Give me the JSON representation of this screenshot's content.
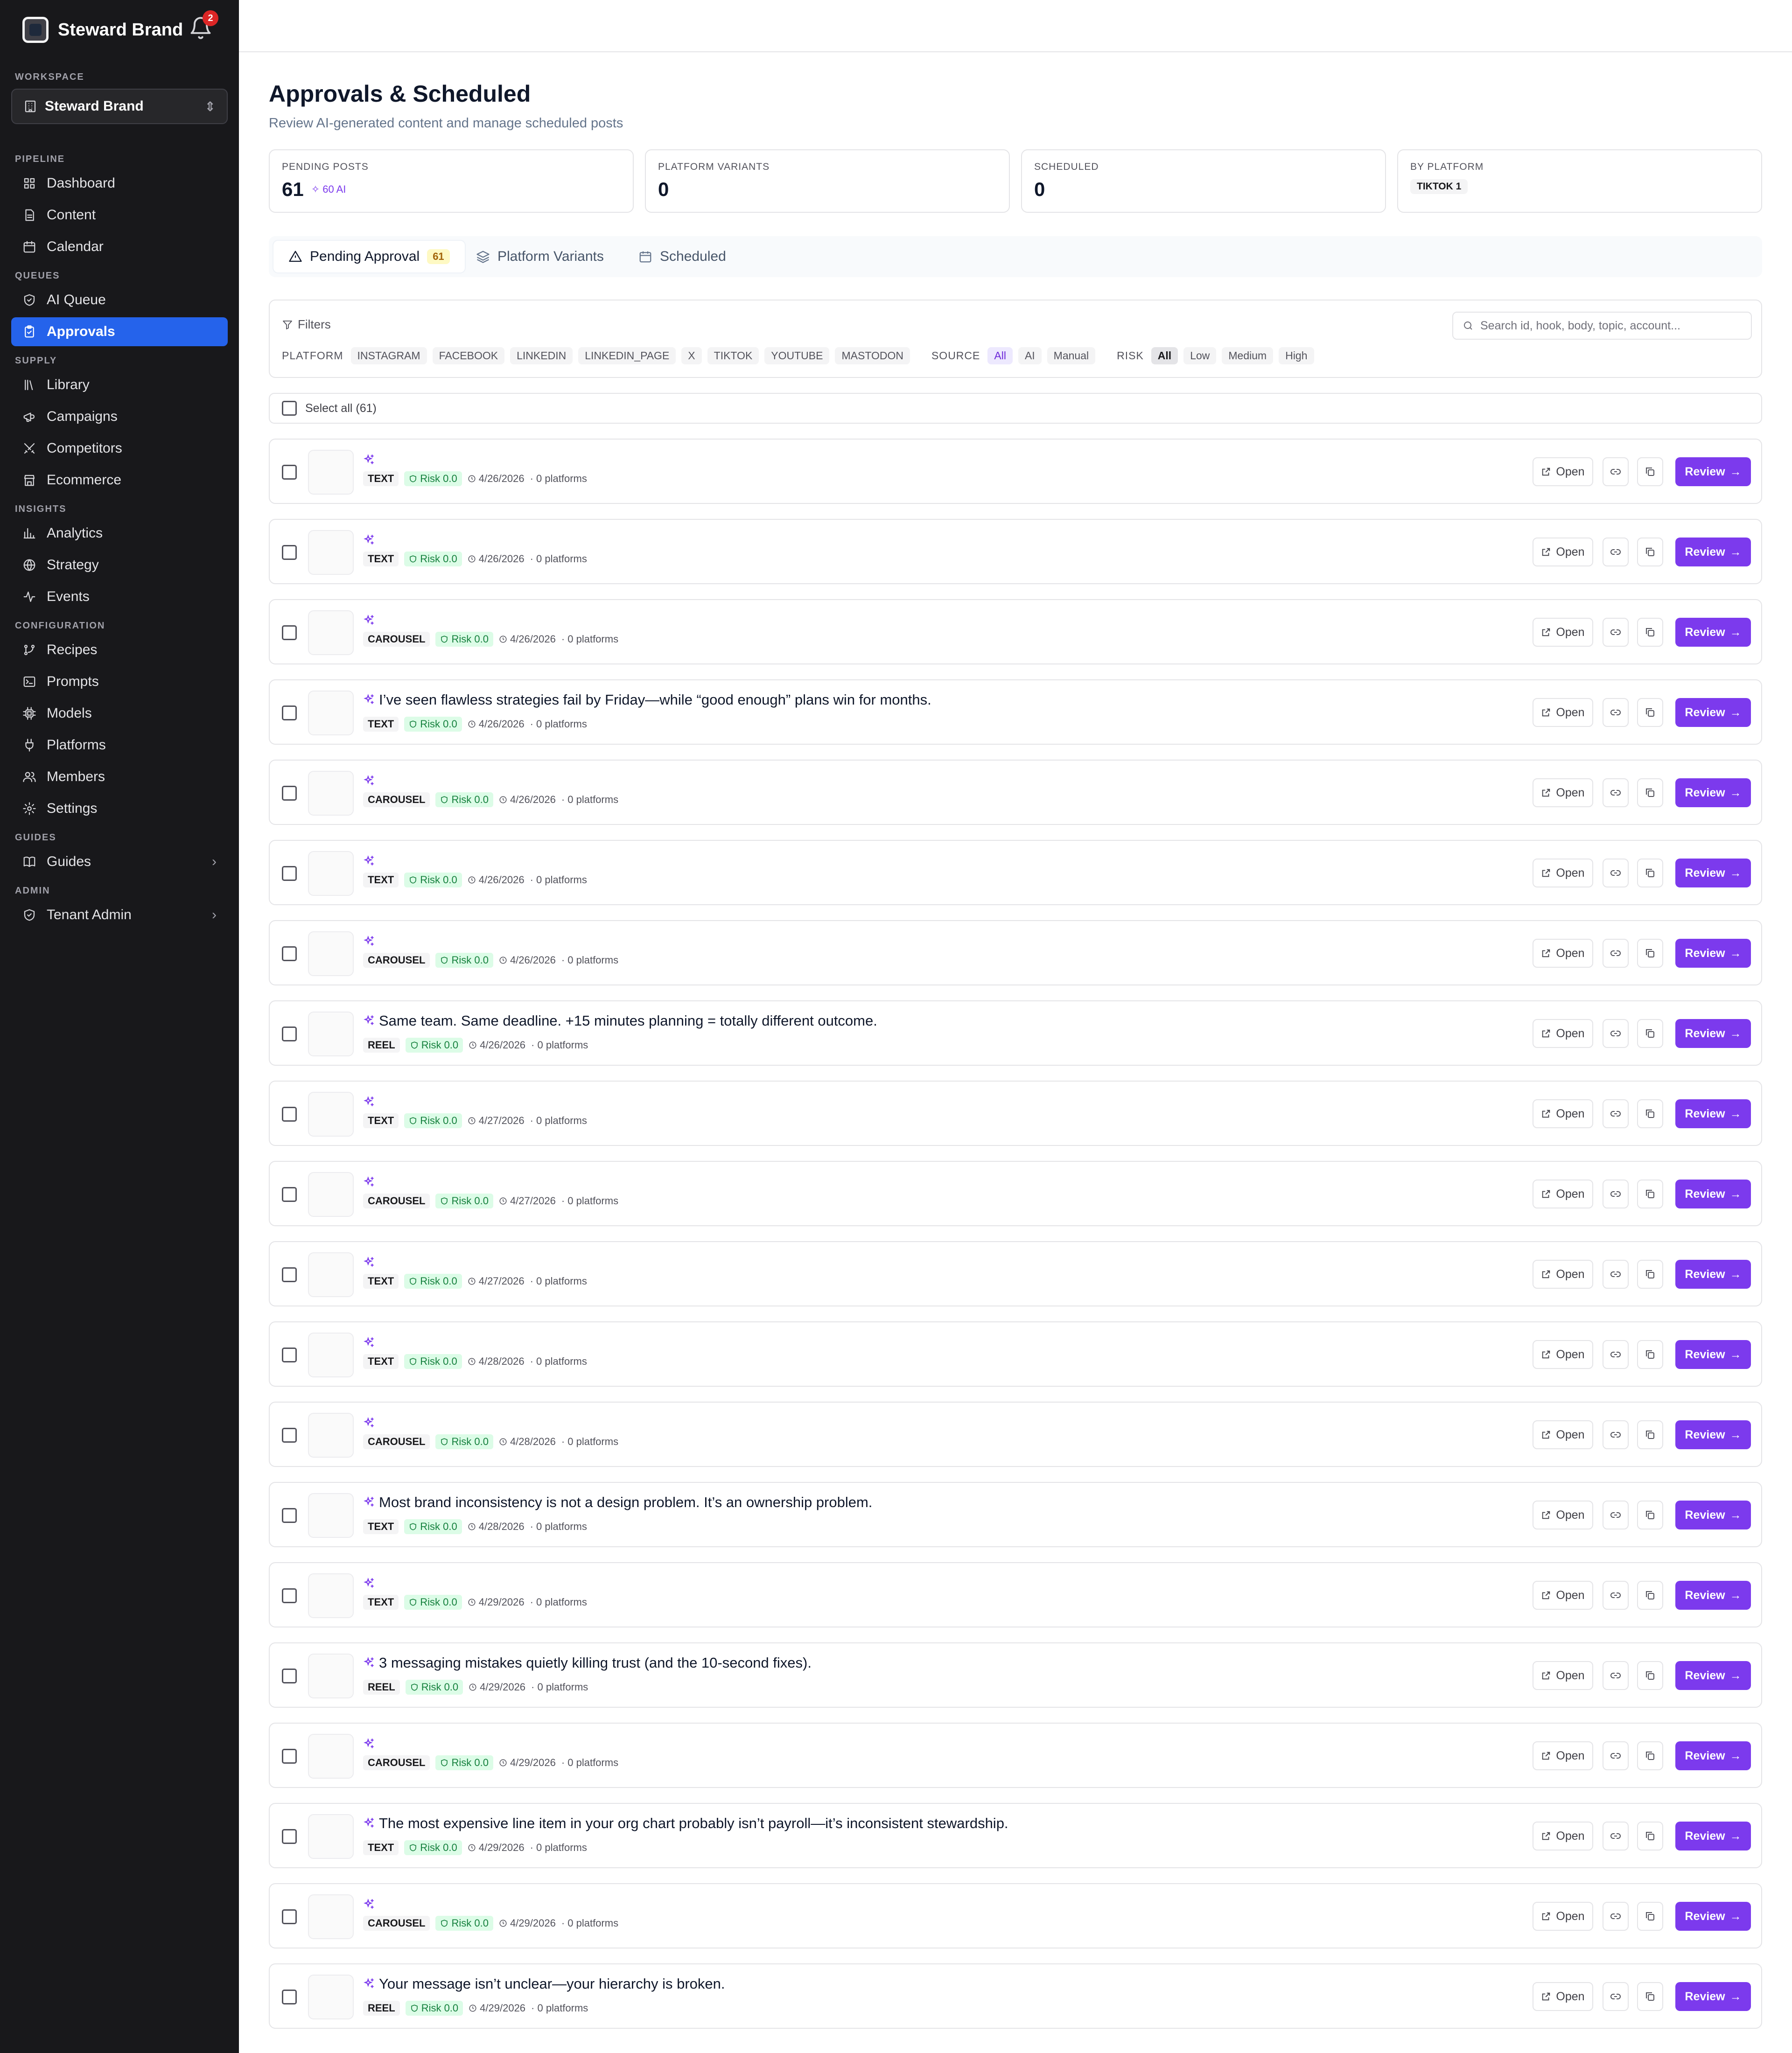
{
  "app": {
    "brand": "Steward Brand",
    "notification_count": "2",
    "workspace_label": "WORKSPACE",
    "workspace_value": "Steward Brand"
  },
  "sidebar": {
    "sections": [
      {
        "label": "PIPELINE",
        "items": [
          {
            "label": "Dashboard",
            "icon": "grid-icon"
          },
          {
            "label": "Content",
            "icon": "file-icon"
          },
          {
            "label": "Calendar",
            "icon": "calendar-icon"
          }
        ]
      },
      {
        "label": "QUEUES",
        "items": [
          {
            "label": "AI Queue",
            "icon": "shield-icon"
          },
          {
            "label": "Approvals",
            "icon": "clipboard-icon",
            "active": true
          }
        ]
      },
      {
        "label": "SUPPLY",
        "items": [
          {
            "label": "Library",
            "icon": "library-icon"
          },
          {
            "label": "Campaigns",
            "icon": "megaphone-icon"
          },
          {
            "label": "Competitors",
            "icon": "swords-icon"
          },
          {
            "label": "Ecommerce",
            "icon": "store-icon"
          }
        ]
      },
      {
        "label": "INSIGHTS",
        "items": [
          {
            "label": "Analytics",
            "icon": "bar-chart-icon"
          },
          {
            "label": "Strategy",
            "icon": "globe-icon"
          },
          {
            "label": "Events",
            "icon": "activity-icon"
          }
        ]
      },
      {
        "label": "CONFIGURATION",
        "items": [
          {
            "label": "Recipes",
            "icon": "git-branch-icon"
          },
          {
            "label": "Prompts",
            "icon": "terminal-icon"
          },
          {
            "label": "Models",
            "icon": "cpu-icon"
          },
          {
            "label": "Platforms",
            "icon": "plug-icon"
          },
          {
            "label": "Members",
            "icon": "users-icon"
          },
          {
            "label": "Settings",
            "icon": "gear-icon"
          }
        ]
      },
      {
        "label": "GUIDES",
        "items": [
          {
            "label": "Guides",
            "icon": "book-icon",
            "expandable": true
          }
        ]
      },
      {
        "label": "ADMIN",
        "items": [
          {
            "label": "Tenant Admin",
            "icon": "shield-icon",
            "expandable": true
          }
        ]
      }
    ]
  },
  "page": {
    "title": "Approvals & Scheduled",
    "subtitle": "Review AI-generated content and manage scheduled posts"
  },
  "stats": [
    {
      "label": "PENDING POSTS",
      "value": "61",
      "extra": "60 AI"
    },
    {
      "label": "PLATFORM VARIANTS",
      "value": "0"
    },
    {
      "label": "SCHEDULED",
      "value": "0"
    },
    {
      "label": "BY PLATFORM",
      "chip": "TIKTOK 1"
    }
  ],
  "tabs": [
    {
      "label": "Pending Approval",
      "count": "61",
      "icon": "alert-triangle-icon",
      "active": true
    },
    {
      "label": "Platform Variants",
      "icon": "layers-icon"
    },
    {
      "label": "Scheduled",
      "icon": "calendar-icon"
    }
  ],
  "filters": {
    "label": "Filters",
    "search_placeholder": "Search id, hook, body, topic, account...",
    "platform_label": "PLATFORM",
    "platforms": [
      "INSTAGRAM",
      "FACEBOOK",
      "LINKEDIN",
      "LINKEDIN_PAGE",
      "X",
      "TIKTOK",
      "YOUTUBE",
      "MASTODON"
    ],
    "source_label": "SOURCE",
    "sources": [
      "All",
      "AI",
      "Manual"
    ],
    "source_selected": "All",
    "risk_label": "RISK",
    "risks": [
      "All",
      "Low",
      "Medium",
      "High"
    ],
    "risk_selected": "All"
  },
  "select_all_label": "Select all (61)",
  "actions": {
    "open": "Open",
    "review": "Review"
  },
  "posts": [
    {
      "hook": "",
      "type": "TEXT",
      "risk": "Risk 0.0",
      "date": "4/26/2026",
      "platforms": "· 0 platforms"
    },
    {
      "hook": "",
      "type": "TEXT",
      "risk": "Risk 0.0",
      "date": "4/26/2026",
      "platforms": "· 0 platforms"
    },
    {
      "hook": "",
      "type": "CAROUSEL",
      "risk": "Risk 0.0",
      "date": "4/26/2026",
      "platforms": "· 0 platforms"
    },
    {
      "hook": "I’ve seen flawless strategies fail by Friday—while “good enough” plans win for months.",
      "type": "TEXT",
      "risk": "Risk 0.0",
      "date": "4/26/2026",
      "platforms": "· 0 platforms"
    },
    {
      "hook": "",
      "type": "CAROUSEL",
      "risk": "Risk 0.0",
      "date": "4/26/2026",
      "platforms": "· 0 platforms"
    },
    {
      "hook": "",
      "type": "TEXT",
      "risk": "Risk 0.0",
      "date": "4/26/2026",
      "platforms": "· 0 platforms"
    },
    {
      "hook": "",
      "type": "CAROUSEL",
      "risk": "Risk 0.0",
      "date": "4/26/2026",
      "platforms": "· 0 platforms"
    },
    {
      "hook": "Same team. Same deadline. +15 minutes planning = totally different outcome.",
      "type": "REEL",
      "risk": "Risk 0.0",
      "date": "4/26/2026",
      "platforms": "· 0 platforms"
    },
    {
      "hook": "",
      "type": "TEXT",
      "risk": "Risk 0.0",
      "date": "4/27/2026",
      "platforms": "· 0 platforms"
    },
    {
      "hook": "",
      "type": "CAROUSEL",
      "risk": "Risk 0.0",
      "date": "4/27/2026",
      "platforms": "· 0 platforms"
    },
    {
      "hook": "",
      "type": "TEXT",
      "risk": "Risk 0.0",
      "date": "4/27/2026",
      "platforms": "· 0 platforms"
    },
    {
      "hook": "",
      "type": "TEXT",
      "risk": "Risk 0.0",
      "date": "4/28/2026",
      "platforms": "· 0 platforms"
    },
    {
      "hook": "",
      "type": "CAROUSEL",
      "risk": "Risk 0.0",
      "date": "4/28/2026",
      "platforms": "· 0 platforms"
    },
    {
      "hook": "Most brand inconsistency is not a design problem. It’s an ownership problem.",
      "type": "TEXT",
      "risk": "Risk 0.0",
      "date": "4/28/2026",
      "platforms": "· 0 platforms"
    },
    {
      "hook": "",
      "type": "TEXT",
      "risk": "Risk 0.0",
      "date": "4/29/2026",
      "platforms": "· 0 platforms"
    },
    {
      "hook": "3 messaging mistakes quietly killing trust (and the 10-second fixes).",
      "type": "REEL",
      "risk": "Risk 0.0",
      "date": "4/29/2026",
      "platforms": "· 0 platforms"
    },
    {
      "hook": "",
      "type": "CAROUSEL",
      "risk": "Risk 0.0",
      "date": "4/29/2026",
      "platforms": "· 0 platforms"
    },
    {
      "hook": "The most expensive line item in your org chart probably isn’t payroll—it’s inconsistent stewardship.",
      "type": "TEXT",
      "risk": "Risk 0.0",
      "date": "4/29/2026",
      "platforms": "· 0 platforms"
    },
    {
      "hook": "",
      "type": "CAROUSEL",
      "risk": "Risk 0.0",
      "date": "4/29/2026",
      "platforms": "· 0 platforms"
    },
    {
      "hook": "Your message isn’t unclear—your hierarchy is broken.",
      "type": "REEL",
      "risk": "Risk 0.0",
      "date": "4/29/2026",
      "platforms": "· 0 platforms"
    }
  ],
  "colors": {
    "accent_purple": "#7c3aed",
    "active_blue": "#2563eb",
    "sidebar_bg": "#18181b",
    "risk_green": "#15803d"
  }
}
